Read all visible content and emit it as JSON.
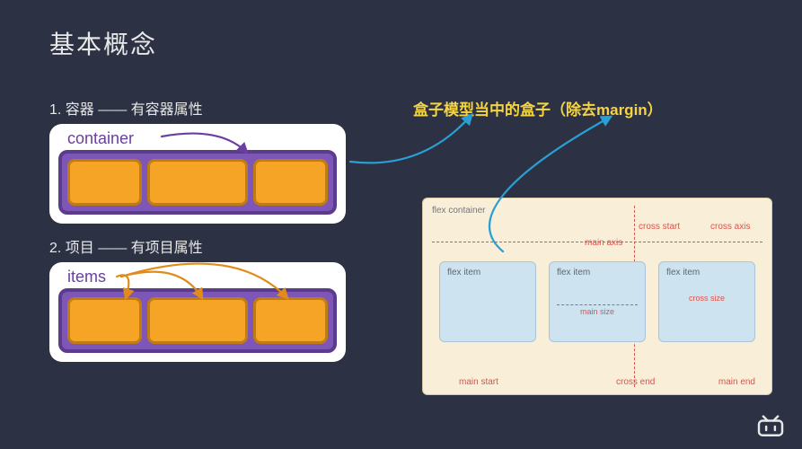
{
  "title": "基本概念",
  "section1": "1. 容器 —— 有容器属性",
  "section2": "2. 项目 —— 有项目属性",
  "callout": "盒子模型当中的盒子（除去margin）",
  "card1": {
    "label": "container"
  },
  "card2": {
    "label": "items"
  },
  "flexspec": {
    "container": "flex container",
    "item": "flex item",
    "cross_start": "cross start",
    "cross_axis": "cross axis",
    "main_axis": "main axis",
    "main_start": "main start",
    "cross_end": "cross end",
    "main_end": "main end",
    "main_size": "main size",
    "cross_size": "cross size"
  }
}
